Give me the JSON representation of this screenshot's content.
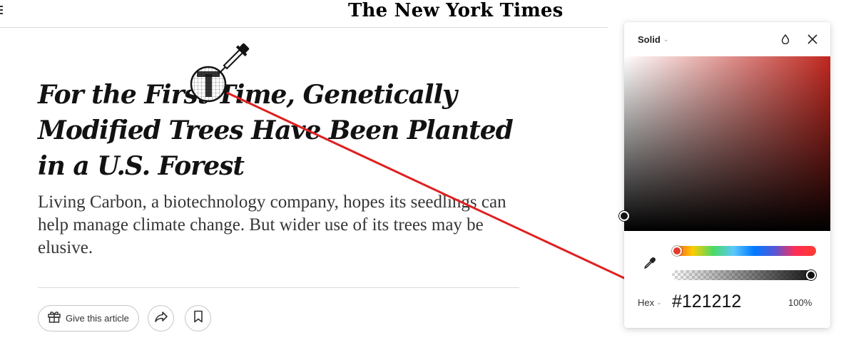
{
  "article": {
    "masthead": "The New York Times",
    "headline": "For the First Time, Genetically Modified Trees Have Been Planted in a U.S. Forest",
    "summary": "Living Carbon, a biotechnology company, hopes its seedlings can help manage climate change. But wider use of its trees may be elusive.",
    "gift_button_label": "Give this article",
    "icons": {
      "menu": "hamburger-icon",
      "gift": "gift-icon",
      "share": "share-arrow-icon",
      "save": "bookmark-icon",
      "cursor": "eyedropper-magnifier-icon"
    }
  },
  "color_picker": {
    "mode": "Solid",
    "format": "Hex",
    "hex": "#121212",
    "opacity": "100%",
    "base_hue_color": "#c0271f",
    "icons": {
      "mode_chevron": "chevron-down-icon",
      "format_chevron": "chevron-down-icon",
      "drop": "water-drop-icon",
      "close": "close-icon",
      "eyedropper": "eyedropper-icon"
    }
  },
  "annotation": {
    "arrow_color": "#e02020"
  }
}
